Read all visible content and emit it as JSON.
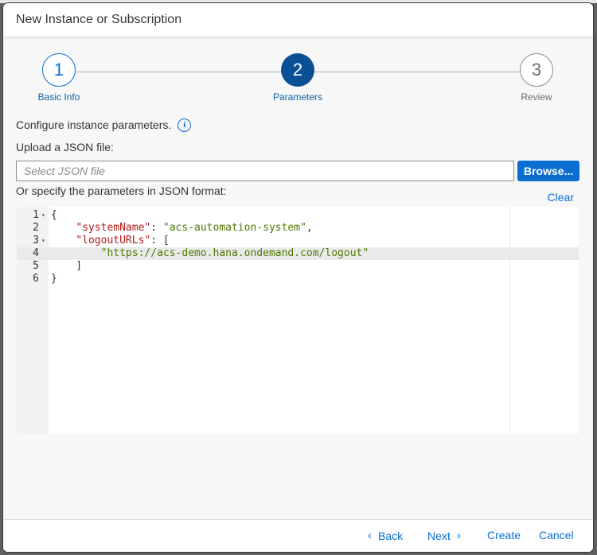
{
  "dialog": {
    "title": "New Instance or Subscription"
  },
  "wizard": {
    "steps": [
      {
        "number": "1",
        "label": "Basic Info",
        "state": "completed"
      },
      {
        "number": "2",
        "label": "Parameters",
        "state": "active"
      },
      {
        "number": "3",
        "label": "Review",
        "state": "pending"
      }
    ]
  },
  "intro": {
    "text": "Configure instance parameters.",
    "icon": "info-icon"
  },
  "upload": {
    "label": "Upload a JSON file:",
    "input_placeholder": "Select JSON file",
    "input_value": "",
    "browse_label": "Browse..."
  },
  "json_section": {
    "label": "Or specify the parameters in JSON format:",
    "clear_label": "Clear"
  },
  "editor": {
    "active_line": 4,
    "lines": [
      {
        "num": "1",
        "fold": "▾",
        "text": "{"
      },
      {
        "num": "2",
        "fold": "",
        "text": "    \"systemName\": \"acs-automation-system\","
      },
      {
        "num": "3",
        "fold": "▾",
        "text": "    \"logoutURLs\": ["
      },
      {
        "num": "4",
        "fold": "",
        "text": "        \"https://acs-demo.hana.ondemand.com/logout\""
      },
      {
        "num": "5",
        "fold": "",
        "text": "    ]"
      },
      {
        "num": "6",
        "fold": "",
        "text": "}"
      }
    ]
  },
  "footer": {
    "back_label": "Back",
    "next_label": "Next",
    "create_label": "Create",
    "cancel_label": "Cancel"
  },
  "colors": {
    "accent": "#0a6ed1",
    "active_step": "#0b4f94",
    "json_key": "#b41a1a",
    "json_string": "#4e7a00"
  }
}
